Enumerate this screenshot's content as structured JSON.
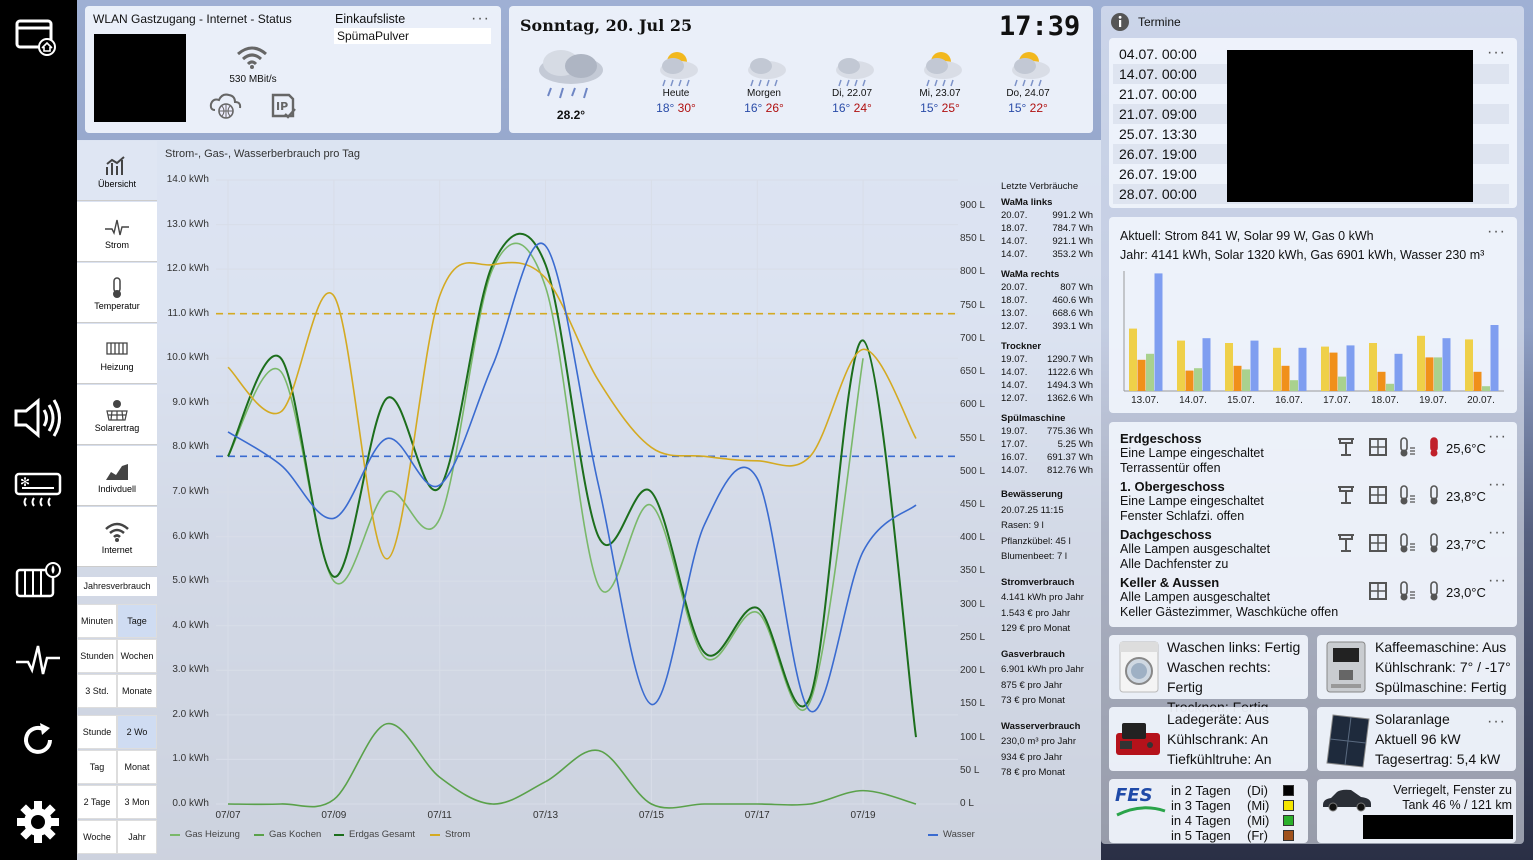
{
  "sidebar": {
    "icons": [
      "home-window-icon",
      "speaker-icon",
      "climate-icon",
      "heater-icon",
      "pulse-icon",
      "refresh-icon",
      "gear-icon"
    ]
  },
  "status": {
    "title": "WLAN Gastzugang - Internet - Status",
    "speed": "530 MBit/s"
  },
  "shopping": {
    "title": "Einkaufsliste",
    "item": "SpümaPulver"
  },
  "weather": {
    "date": "Sonntag, 20. Jul 25",
    "time": "17:39",
    "current_temp": "28.2°",
    "days": [
      {
        "name": "Heute",
        "lo": "18°",
        "hi": "30°"
      },
      {
        "name": "Morgen",
        "lo": "16°",
        "hi": "26°"
      },
      {
        "name": "Di, 22.07",
        "lo": "16°",
        "hi": "24°"
      },
      {
        "name": "Mi, 23.07",
        "lo": "15°",
        "hi": "25°"
      },
      {
        "name": "Do, 24.07",
        "lo": "15°",
        "hi": "22°"
      }
    ]
  },
  "menu": {
    "items": [
      {
        "label": "Übersicht"
      },
      {
        "label": "Strom"
      },
      {
        "label": "Temperatur"
      },
      {
        "label": "Heizung"
      },
      {
        "label": "Solarertrag"
      },
      {
        "label": "Indivduell"
      },
      {
        "label": "Internet"
      }
    ],
    "jahresverbrauch": "Jahresverbrauch",
    "grid1": [
      "Minuten",
      "Tage",
      "Stunden",
      "Wochen",
      "3 Std.",
      "Monate"
    ],
    "grid2": [
      "Stunde",
      "2 Wo",
      "Tag",
      "Monat",
      "2 Tage",
      "3 Mon",
      "Woche",
      "Jahr"
    ]
  },
  "chart_data": {
    "type": "line",
    "title": "Strom-, Gas-, Wasserberbrauch pro Tag",
    "x": [
      "07/07",
      "07/08",
      "07/09",
      "07/10",
      "07/11",
      "07/12",
      "07/13",
      "07/14",
      "07/15",
      "07/16",
      "07/17",
      "07/18",
      "07/19",
      "07/20"
    ],
    "x_ticks": [
      "07/07",
      "07/09",
      "07/11",
      "07/13",
      "07/15",
      "07/17",
      "07/19"
    ],
    "y_ticks": [
      "0.0 kWh",
      "1.0 kWh",
      "2.0 kWh",
      "3.0 kWh",
      "4.0 kWh",
      "5.0 kWh",
      "6.0 kWh",
      "7.0 kWh",
      "8.0 kWh",
      "9.0 kWh",
      "10.0 kWh",
      "11.0 kWh",
      "12.0 kWh",
      "13.0 kWh",
      "14.0 kWh"
    ],
    "y2_ticks": [
      "0 L",
      "50 L",
      "100 L",
      "150 L",
      "200 L",
      "250 L",
      "300 L",
      "350 L",
      "400 L",
      "450 L",
      "500 L",
      "550 L",
      "600 L",
      "650 L",
      "700 L",
      "750 L",
      "800 L",
      "850 L",
      "900 L"
    ],
    "ylim": [
      0,
      14
    ],
    "y2lim": [
      0,
      900
    ],
    "series": [
      {
        "name": "Gas Heizung",
        "color": "#7ab86a",
        "axis": "left",
        "values": [
          7.8,
          9.7,
          5.0,
          7.0,
          6.4,
          12.0,
          11.6,
          4.9,
          6.7,
          3.3,
          4.3,
          2.3,
          10.0,
          null
        ]
      },
      {
        "name": "Gas Kochen",
        "color": "#5aa14a",
        "axis": "left",
        "values": [
          0,
          0,
          0.1,
          1.8,
          0.6,
          0,
          0.5,
          1.2,
          0,
          0,
          0,
          0,
          0.3,
          0
        ]
      },
      {
        "name": "Erdgas Gesamt",
        "color": "#1c6e1c",
        "axis": "left",
        "values": [
          7.8,
          10.0,
          5.1,
          9.1,
          7.1,
          12.1,
          12.1,
          6.0,
          7.0,
          3.4,
          4.4,
          2.4,
          10.4,
          1.5
        ]
      },
      {
        "name": "Strom",
        "color": "#d4aa22",
        "axis": "left",
        "values": [
          9.8,
          8.8,
          11.4,
          5.5,
          11.4,
          12.1,
          11.8,
          9.5,
          8.0,
          7.8,
          7.7,
          7.8,
          10.2,
          8.2
        ]
      },
      {
        "name": "Wasser",
        "color": "#3a6bd0",
        "axis": "right",
        "values": [
          560,
          510,
          430,
          550,
          480,
          660,
          840,
          480,
          150,
          420,
          490,
          140,
          380,
          450
        ]
      }
    ],
    "ref_lines": [
      {
        "axis": "left",
        "value": 11.0,
        "color": "#d4aa22"
      },
      {
        "axis": "left",
        "value": 7.8,
        "color": "#3a6bd0"
      }
    ]
  },
  "verbrauch": {
    "header": "Letzte Verbräuche",
    "groups": [
      {
        "title": "WaMa links",
        "rows": [
          [
            "20.07.",
            "991.2 Wh"
          ],
          [
            "18.07.",
            "784.7 Wh"
          ],
          [
            "14.07.",
            "921.1 Wh"
          ],
          [
            "14.07.",
            "353.2 Wh"
          ]
        ]
      },
      {
        "title": "WaMa rechts",
        "rows": [
          [
            "20.07.",
            "807 Wh"
          ],
          [
            "18.07.",
            "460.6 Wh"
          ],
          [
            "13.07.",
            "668.6 Wh"
          ],
          [
            "12.07.",
            "393.1 Wh"
          ]
        ]
      },
      {
        "title": "Trockner",
        "rows": [
          [
            "19.07.",
            "1290.7 Wh"
          ],
          [
            "14.07.",
            "1122.6 Wh"
          ],
          [
            "14.07.",
            "1494.3 Wh"
          ],
          [
            "12.07.",
            "1362.6 Wh"
          ]
        ]
      },
      {
        "title": "Spülmaschine",
        "rows": [
          [
            "19.07.",
            "775.36 Wh"
          ],
          [
            "17.07.",
            "5.25 Wh"
          ],
          [
            "16.07.",
            "691.37 Wh"
          ],
          [
            "14.07.",
            "812.76 Wh"
          ]
        ]
      }
    ],
    "bewaesserung": {
      "title": "Bewässerung",
      "lines": [
        "20.07.25 11:15",
        "Rasen: 9 l",
        "Pflanzkübel: 45 l",
        "Blumenbeet: 7 l"
      ]
    },
    "strom": {
      "title": "Stromverbrauch",
      "lines": [
        "4.141 kWh pro Jahr",
        "1.543 € pro Jahr",
        "129 € pro Monat"
      ]
    },
    "gas": {
      "title": "Gasverbrauch",
      "lines": [
        "6.901 kWh pro Jahr",
        "875 € pro Jahr",
        "73 € pro Monat"
      ]
    },
    "wasser": {
      "title": "Wasserverbrauch",
      "lines": [
        "230,0 m³ pro Jahr",
        "934 € pro Jahr",
        "78 € pro Monat"
      ]
    }
  },
  "termine": {
    "title": "Termine",
    "rows": [
      "04.07. 00:00",
      "14.07. 00:00",
      "21.07. 00:00",
      "21.07. 09:00",
      "25.07. 13:30",
      "26.07. 19:00",
      "26.07. 19:00",
      "28.07. 00:00"
    ]
  },
  "energy": {
    "line1": "Aktuell: Strom 841 W, Solar 99 W, Gas 0 kWh",
    "line2": "Jahr: 4141 kWh, Solar 1320 kWh, Gas 6901 kWh, Wasser 230 m³",
    "dates": [
      "13.07.",
      "14.07.",
      "15.07.",
      "16.07.",
      "17.07.",
      "18.07.",
      "19.07.",
      "20.07."
    ],
    "bars": [
      [
        0.52,
        0.26,
        0.31,
        0.98
      ],
      [
        0.42,
        0.17,
        0.19,
        0.44
      ],
      [
        0.4,
        0.21,
        0.18,
        0.42
      ],
      [
        0.36,
        0.21,
        0.09,
        0.36
      ],
      [
        0.37,
        0.32,
        0.12,
        0.38
      ],
      [
        0.4,
        0.16,
        0.06,
        0.31
      ],
      [
        0.46,
        0.28,
        0.28,
        0.44
      ],
      [
        0.43,
        0.16,
        0.04,
        0.55
      ]
    ],
    "bar_colors": [
      "#efd049",
      "#f0901a",
      "#a9d18e",
      "#7f9ef0"
    ]
  },
  "rooms": [
    {
      "name": "Erdgeschoss",
      "l1": "Eine Lampe eingeschaltet",
      "l2": "Terrassentür offen",
      "temp": "25,6°C",
      "hot": true
    },
    {
      "name": "1. Obergeschoss",
      "l1": "Eine Lampe eingeschaltet",
      "l2": "Fenster Schlafzi. offen",
      "temp": "23,8°C",
      "hot": false
    },
    {
      "name": "Dachgeschoss",
      "l1": "Alle Lampen ausgeschaltet",
      "l2": "Alle Dachfenster zu",
      "temp": "23,7°C",
      "hot": false
    },
    {
      "name": "Keller & Aussen",
      "l1": "Alle Lampen ausgeschaltet",
      "l2": "Keller Gästezimmer, Waschküche offen",
      "temp": "23,0°C",
      "hot": false
    }
  ],
  "devices": {
    "wasch": [
      "Waschen links: Fertig",
      "Waschen rechts: Fertig",
      "Trocknen: Fertig"
    ],
    "kaffee": [
      "Kaffeemaschine: Aus",
      "Kühlschrank: 7° / -17°",
      "Spülmaschine: Fertig"
    ],
    "lade": [
      "Ladegeräte: Aus",
      "Kühlschrank: An",
      "Tiefkühltruhe: An"
    ],
    "solar": [
      "Solaranlage",
      "Aktuell 96 kW",
      "Tagesertrag: 5,4 kW"
    ]
  },
  "fes": {
    "logo": "FES",
    "rows": [
      {
        "when": "in 2 Tagen",
        "day": "(Di)",
        "color": "#000000"
      },
      {
        "when": "in 3 Tagen",
        "day": "(Mi)",
        "color": "#f5e600"
      },
      {
        "when": "in 4 Tagen",
        "day": "(Mi)",
        "color": "#2bb02b"
      },
      {
        "when": "in 5 Tagen",
        "day": "(Fr)",
        "color": "#a0521c"
      }
    ]
  },
  "car": {
    "l1": "Verriegelt, Fenster zu",
    "l2": "Tank 46 % / 121 km"
  }
}
